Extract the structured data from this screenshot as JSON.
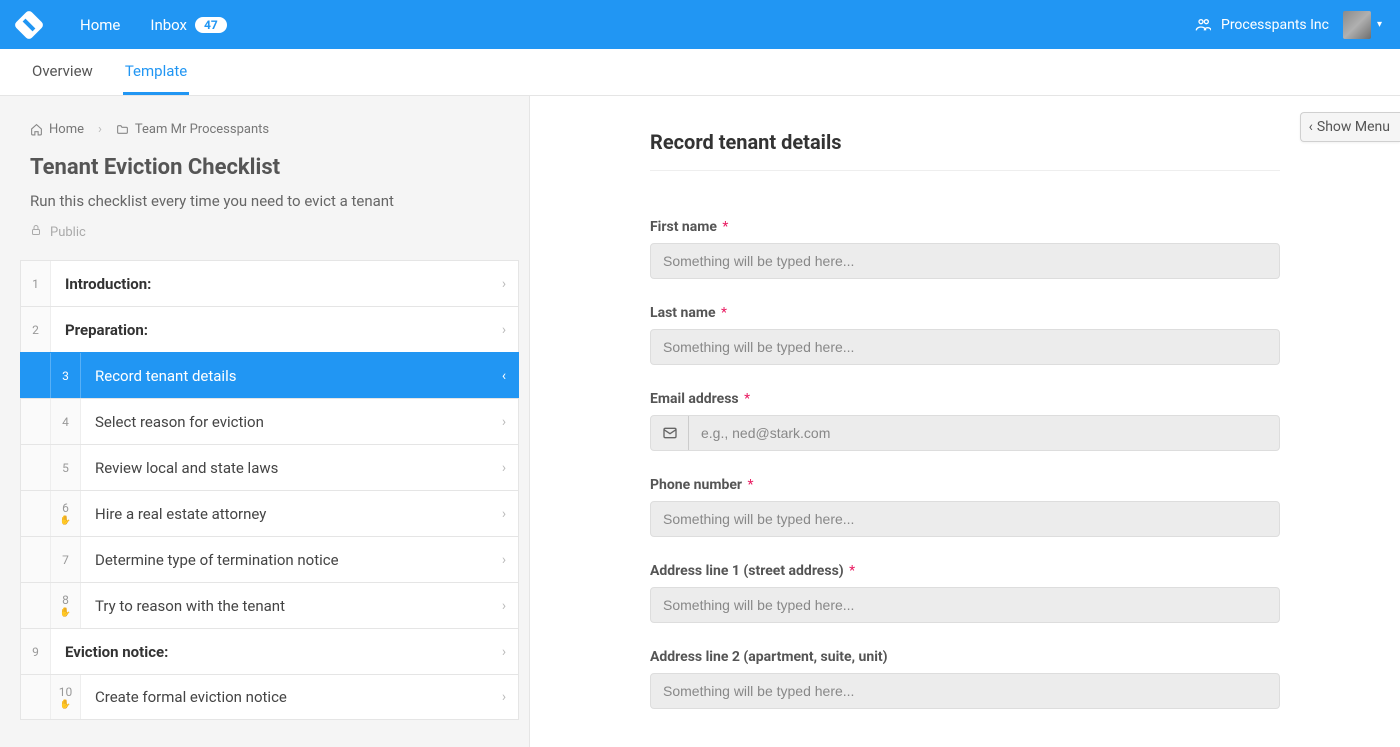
{
  "topbar": {
    "home": "Home",
    "inbox": "Inbox",
    "inbox_badge": "47",
    "org_name": "Processpants Inc"
  },
  "tabs": {
    "overview": "Overview",
    "template": "Template"
  },
  "breadcrumb": {
    "home": "Home",
    "team": "Team Mr Processpants"
  },
  "page": {
    "title": "Tenant Eviction Checklist",
    "subtitle": "Run this checklist every time you need to evict a tenant",
    "visibility": "Public"
  },
  "checklist": [
    {
      "num": "1",
      "label": "Introduction:",
      "heading": true
    },
    {
      "num": "2",
      "label": "Preparation:",
      "heading": true
    },
    {
      "num": "3",
      "label": "Record tenant details",
      "active": true,
      "indent": true
    },
    {
      "num": "4",
      "label": "Select reason for eviction",
      "indent": true
    },
    {
      "num": "5",
      "label": "Review local and state laws",
      "indent": true
    },
    {
      "num": "6",
      "label": "Hire a real estate attorney",
      "indent": true,
      "stop": true
    },
    {
      "num": "7",
      "label": "Determine type of termination notice",
      "indent": true
    },
    {
      "num": "8",
      "label": "Try to reason with the tenant",
      "indent": true,
      "stop": true
    },
    {
      "num": "9",
      "label": "Eviction notice:",
      "heading": true
    },
    {
      "num": "10",
      "label": "Create formal eviction notice",
      "indent": true,
      "stop": true
    }
  ],
  "panel": {
    "title": "Record tenant details",
    "show_menu": "Show Menu",
    "fields": [
      {
        "label": "First name",
        "required": true,
        "placeholder": "Something will be typed here...",
        "type": "text"
      },
      {
        "label": "Last name",
        "required": true,
        "placeholder": "Something will be typed here...",
        "type": "text"
      },
      {
        "label": "Email address",
        "required": true,
        "placeholder": "e.g., ned@stark.com",
        "type": "email"
      },
      {
        "label": "Phone number",
        "required": true,
        "placeholder": "Something will be typed here...",
        "type": "text"
      },
      {
        "label": "Address line 1 (street address)",
        "required": true,
        "placeholder": "Something will be typed here...",
        "type": "text"
      },
      {
        "label": "Address line 2 (apartment, suite, unit)",
        "required": false,
        "placeholder": "Something will be typed here...",
        "type": "text"
      }
    ]
  }
}
